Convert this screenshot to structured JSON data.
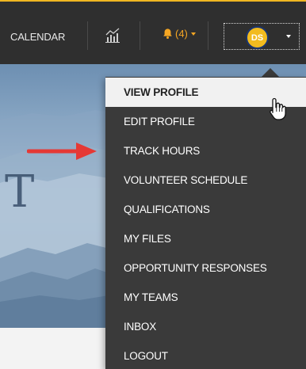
{
  "topbar": {
    "calendar_label": "CALENDAR",
    "chart_icon": "bar-chart-icon",
    "notifications": {
      "icon": "bell-icon",
      "count_label": "(4)"
    },
    "profile": {
      "initials": "DS",
      "caret_icon": "caret-down-icon"
    }
  },
  "hero": {
    "partial_title_glyph": "T"
  },
  "annotation": {
    "arrow_icon": "red-arrow-icon",
    "arrow_color": "#e53935"
  },
  "profile_menu": {
    "items": [
      {
        "label": "VIEW PROFILE",
        "active": true
      },
      {
        "label": "EDIT PROFILE"
      },
      {
        "label": "TRACK HOURS"
      },
      {
        "label": "VOLUNTEER SCHEDULE"
      },
      {
        "label": "QUALIFICATIONS"
      },
      {
        "label": "MY FILES"
      },
      {
        "label": "OPPORTUNITY RESPONSES"
      },
      {
        "label": "MY TEAMS"
      },
      {
        "label": "INBOX"
      },
      {
        "label": "LOGOUT"
      }
    ]
  },
  "cursor": {
    "icon": "hand-pointer-icon"
  },
  "colors": {
    "topbar_bg": "#2f2f2f",
    "accent_top_border": "#f0b722",
    "notification_orange": "#f5a623",
    "avatar_bg": "#f2bb1f",
    "avatar_ring": "#1a3570",
    "menu_bg": "#3a3a3a",
    "menu_active_bg": "#f1f1f1"
  }
}
